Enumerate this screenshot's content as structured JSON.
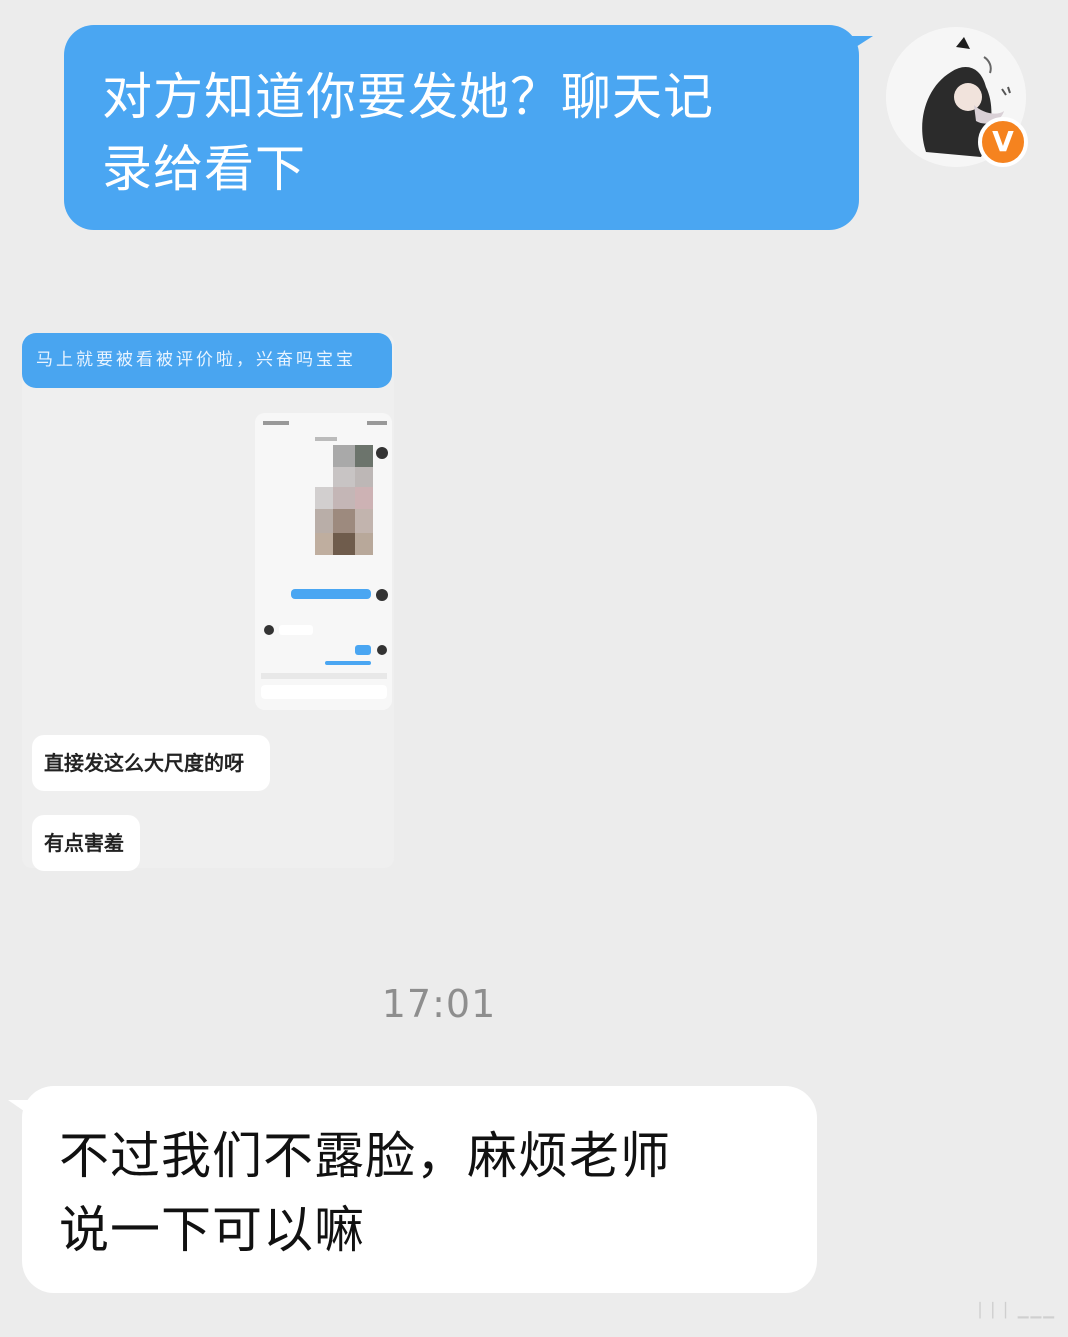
{
  "messages": {
    "outgoing_text": "对方知道你要发她？聊天记录给看下",
    "outgoing_line1": "对方知道你要发她？聊天记",
    "outgoing_line2": "录给看下",
    "incoming_text": "不过我们不露脸，麻烦老师说一下可以嘛",
    "incoming_line1": "不过我们不露脸，麻烦老师",
    "incoming_line2": "说一下可以嘛"
  },
  "avatar": {
    "badge_label": "V",
    "badge_color": "#f5831f",
    "icon": "user-avatar-icon"
  },
  "forwarded_screenshot": {
    "top_bubble_text": "马上就要被看被评价啦，兴奋吗宝宝",
    "reply_1": "直接发这么大尺度的呀",
    "reply_2": "有点害羞"
  },
  "timestamp": "17:01",
  "colors": {
    "outgoing_bubble": "#4aa6f2",
    "incoming_bubble": "#ffffff",
    "background": "#ececec"
  }
}
